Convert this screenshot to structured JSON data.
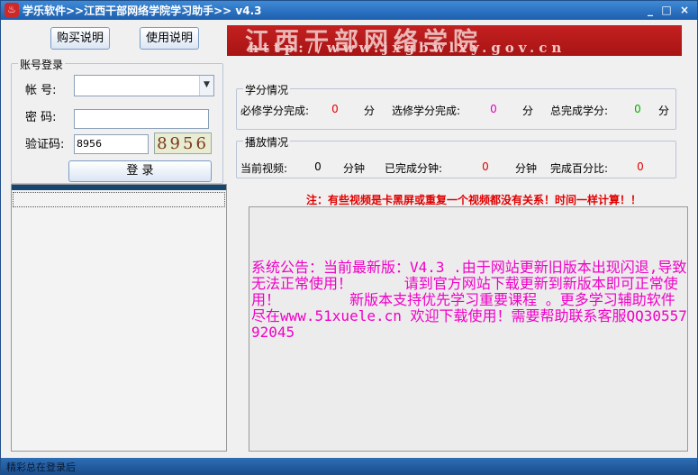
{
  "window": {
    "title": "学乐软件>>江西干部网络学院学习助手>> v4.3",
    "minimize_glyph": "_",
    "maximize_glyph": "□",
    "close_glyph": "×"
  },
  "buttons": {
    "purchase": "购买说明",
    "usage": "使用说明",
    "login": "登 录"
  },
  "banner": {
    "title": "江西干部网络学院",
    "url": "http://www.jxgbwlxy.gov.cn"
  },
  "login": {
    "group_title": "账号登录",
    "account_label": "帐    号:",
    "account_value": "",
    "password_label": "密    码:",
    "password_value": "",
    "captcha_label": "验证码:",
    "captcha_value": "8956",
    "captcha_image_text": "8956"
  },
  "credits": {
    "group_title": "学分情况",
    "required_label": "必修学分完成:",
    "required_value": "0",
    "required_unit": "分",
    "elective_label": "选修学分完成:",
    "elective_value": "0",
    "elective_unit": "分",
    "total_label": "总完成学分:",
    "total_value": "0",
    "total_unit": "分"
  },
  "playback": {
    "group_title": "播放情况",
    "current_label": "当前视频:",
    "current_value": "0",
    "current_unit": "分钟",
    "done_label": "已完成分钟:",
    "done_value": "0",
    "done_unit": "分钟",
    "percent_label": "完成百分比:",
    "percent_value": "0"
  },
  "notice": "注：有些视频是卡黑屏或重复一个视频都没有关系！时间一样计算！！",
  "announcement": "系统公告：当前最新版：V4.3 .由于网站更新旧版本出现闪退,导致无法正常使用！      请到官方网站下载更新到新版本即可正常使用！        新版本支持优先学习重要课程 。更多学习辅助软件尽在www.51xuele.cn 欢迎下载使用！需要帮助联系客服QQ3055792045",
  "status": "精彩总在登录后",
  "colors": {
    "zero_red": "#e00000",
    "zero_magenta": "#e000c0",
    "zero_green": "#00b000"
  }
}
